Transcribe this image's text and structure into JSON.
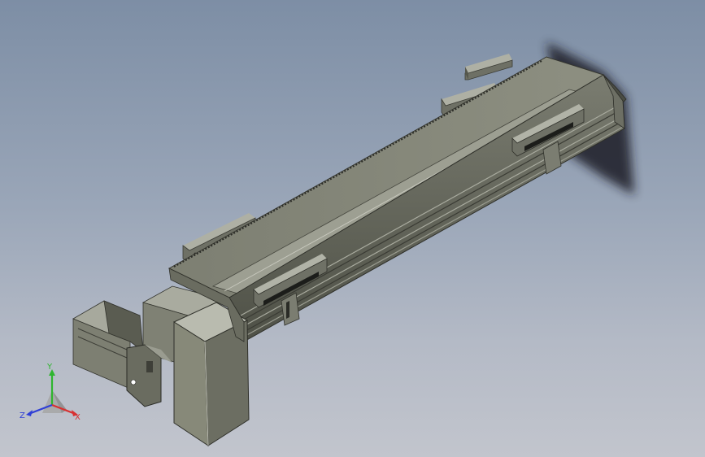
{
  "triad": {
    "x_label": "X",
    "y_label": "Y",
    "z_label": "Z",
    "x_color": "#d83030",
    "y_color": "#2fb52f",
    "z_color": "#2f3fd6"
  },
  "model": {
    "body_color": "#8d8f80",
    "body_dark": "#5c5e52",
    "body_light": "#b4b5a9"
  }
}
